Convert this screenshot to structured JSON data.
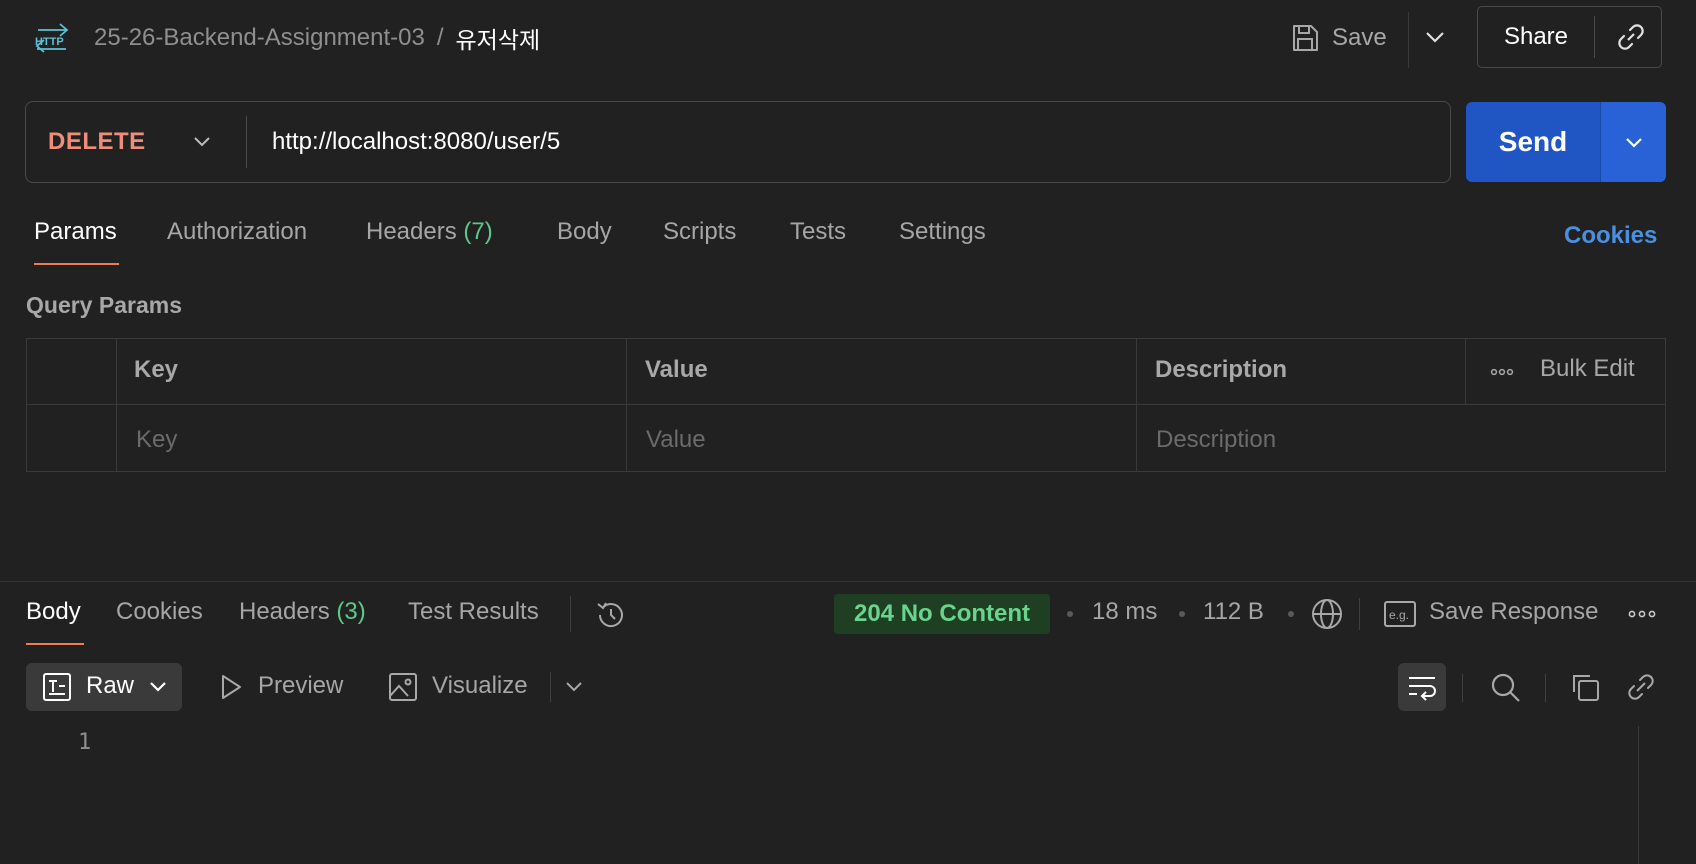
{
  "header": {
    "protocol_icon": "http-icon",
    "collection": "25-26-Backend-Assignment-03",
    "separator": "/",
    "request_name": "유저삭제",
    "save_label": "Save",
    "share_label": "Share"
  },
  "request": {
    "method": "DELETE",
    "url": "http://localhost:8080/user/5",
    "send_label": "Send"
  },
  "request_tabs": {
    "params": "Params",
    "authorization": "Authorization",
    "headers": "Headers",
    "headers_count": "(7)",
    "body": "Body",
    "scripts": "Scripts",
    "tests": "Tests",
    "settings": "Settings",
    "cookies": "Cookies"
  },
  "query_params": {
    "title": "Query Params",
    "columns": {
      "key": "Key",
      "value": "Value",
      "description": "Description"
    },
    "bulk_edit": "Bulk Edit",
    "placeholders": {
      "key": "Key",
      "value": "Value",
      "description": "Description"
    }
  },
  "response": {
    "tabs": {
      "body": "Body",
      "cookies": "Cookies",
      "headers": "Headers",
      "headers_count": "(3)",
      "test_results": "Test Results"
    },
    "status": "204 No Content",
    "time": "18 ms",
    "size": "112 B",
    "save_response": "Save Response",
    "format_label": "Raw",
    "preview_label": "Preview",
    "visualize_label": "Visualize",
    "line_numbers": [
      "1"
    ]
  },
  "colors": {
    "background": "#212121",
    "method_delete": "#f08d7a",
    "send_button": "#1f56c4",
    "accent_underline": "#f07d4f",
    "cookies_link": "#4a90e2",
    "status_text": "#6ad38d",
    "status_bg": "#1e3f22",
    "count_green": "#5cc98a"
  }
}
